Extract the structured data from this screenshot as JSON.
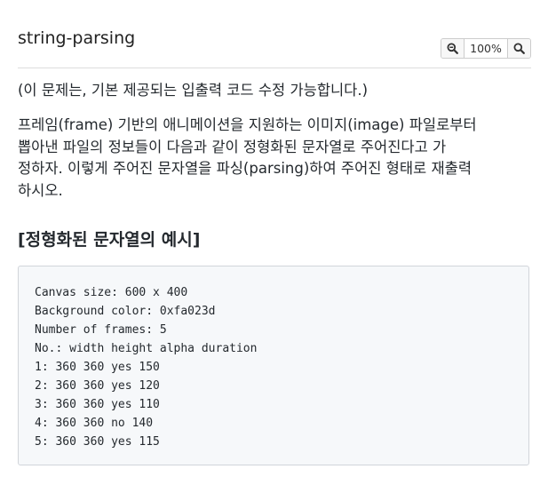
{
  "header": {
    "title": "string-parsing",
    "zoom": {
      "zoom_out_icon": "zoom-out-magnifier-icon",
      "level": "100%",
      "zoom_in_icon": "zoom-in-magnifier-icon"
    }
  },
  "content": {
    "notice": "(이 문제는, 기본 제공되는 입출력 코드 수정 가능합니다.)",
    "description_lines": [
      "프레임(frame) 기반의 애니메이션을 지원하는 이미지(image) 파일로부터",
      "뽑아낸 파일의 정보들이 다음과 같이 정형화된 문자열로 주어진다고 가",
      "정하자. 이렇게 주어진 문자열을 파싱(parsing)하여 주어진 형태로 재출력",
      "하시오."
    ],
    "section_heading": "[정형화된 문자열의 예시]",
    "code_lines": [
      "Canvas size: 600 x 400",
      "Background color: 0xfa023d",
      "Number of frames: 5",
      "No.: width height alpha duration",
      "1: 360 360 yes 150",
      "2: 360 360 yes 120",
      "3: 360 360 yes 110",
      "4: 360 360 no 140",
      "5: 360 360 yes 115"
    ]
  }
}
